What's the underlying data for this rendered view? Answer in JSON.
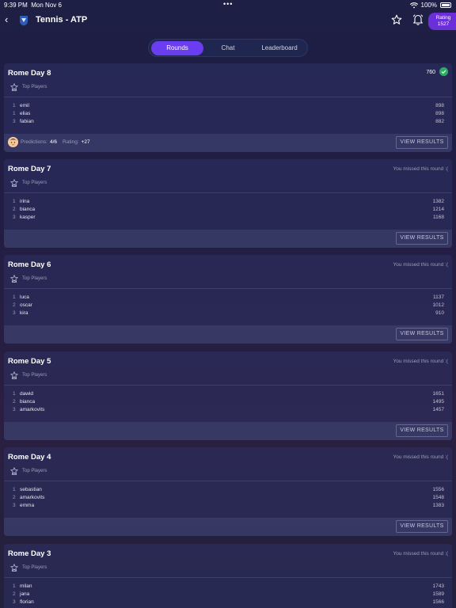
{
  "status_bar": {
    "time": "9:39 PM",
    "date": "Mon Nov 6",
    "dots": "•••",
    "battery": "100%"
  },
  "nav": {
    "back_glyph": "‹",
    "title": "Tennis - ATP",
    "rating_label": "Rating",
    "rating_value": "1527"
  },
  "tabs": [
    {
      "label": "Rounds",
      "active": true
    },
    {
      "label": "Chat",
      "active": false
    },
    {
      "label": "Leaderboard",
      "active": false
    }
  ],
  "section_label": "Top Players",
  "view_results_label": "VIEW RESULTS",
  "rounds": [
    {
      "title": "Rome Day 8",
      "score": "760",
      "completed": true,
      "predictions_label": "Predictions:",
      "predictions_value": "4/6",
      "rating_label": "Rating:",
      "rating_value": "+27",
      "players": [
        {
          "rank": "1",
          "name": "emil",
          "points": "898"
        },
        {
          "rank": "1",
          "name": "elias",
          "points": "898"
        },
        {
          "rank": "3",
          "name": "fabian",
          "points": "882"
        }
      ]
    },
    {
      "title": "Rome Day 7",
      "status": "You missed this round :(",
      "players": [
        {
          "rank": "1",
          "name": "irina",
          "points": "1382"
        },
        {
          "rank": "2",
          "name": "bianca",
          "points": "1214"
        },
        {
          "rank": "3",
          "name": "kasper",
          "points": "1168"
        }
      ]
    },
    {
      "title": "Rome Day 6",
      "status": "You missed this round :(",
      "players": [
        {
          "rank": "1",
          "name": "luca",
          "points": "1137"
        },
        {
          "rank": "2",
          "name": "oscar",
          "points": "1012"
        },
        {
          "rank": "3",
          "name": "kira",
          "points": "910"
        }
      ]
    },
    {
      "title": "Rome Day 5",
      "status": "You missed this round :(",
      "players": [
        {
          "rank": "1",
          "name": "dawid",
          "points": "1651"
        },
        {
          "rank": "2",
          "name": "bianca",
          "points": "1495"
        },
        {
          "rank": "3",
          "name": "amarkovits",
          "points": "1457"
        }
      ]
    },
    {
      "title": "Rome Day 4",
      "status": "You missed this round :(",
      "players": [
        {
          "rank": "1",
          "name": "sebastian",
          "points": "1556"
        },
        {
          "rank": "2",
          "name": "amarkovits",
          "points": "1548"
        },
        {
          "rank": "3",
          "name": "emma",
          "points": "1383"
        }
      ]
    },
    {
      "title": "Rome Day 3",
      "status": "You missed this round :(",
      "players": [
        {
          "rank": "1",
          "name": "milan",
          "points": "1743"
        },
        {
          "rank": "2",
          "name": "jana",
          "points": "1589"
        },
        {
          "rank": "3",
          "name": "florian",
          "points": "1566"
        }
      ]
    }
  ],
  "colors": {
    "accent": "#6b3df0",
    "rating_pill": "#6b2fd9",
    "success": "#27ae60"
  }
}
